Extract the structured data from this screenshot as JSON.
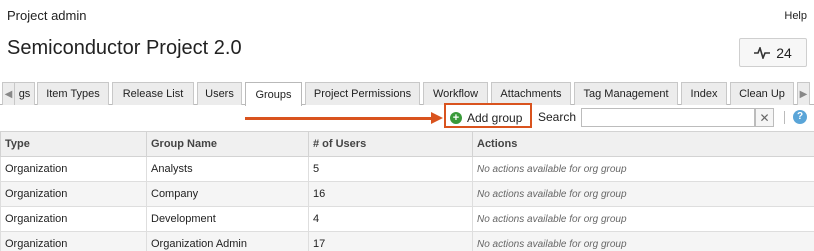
{
  "header": {
    "title": "Project admin",
    "help_label": "Help",
    "project_name": "Semiconductor Project 2.0",
    "activity_count": "24"
  },
  "tabs": {
    "items": [
      {
        "label": "gs"
      },
      {
        "label": "Item Types"
      },
      {
        "label": "Release List"
      },
      {
        "label": "Users"
      },
      {
        "label": "Groups",
        "active": true
      },
      {
        "label": "Project Permissions"
      },
      {
        "label": "Workflow"
      },
      {
        "label": "Attachments"
      },
      {
        "label": "Tag Management"
      },
      {
        "label": "Index"
      },
      {
        "label": "Clean Up"
      }
    ]
  },
  "toolbar": {
    "add_group_label": "Add group",
    "search_label": "Search",
    "search_value": "",
    "search_placeholder": ""
  },
  "table": {
    "columns": [
      "Type",
      "Group Name",
      "# of Users",
      "Actions"
    ],
    "rows": [
      {
        "type": "Organization",
        "name": "Analysts",
        "users": "5",
        "actions": "No actions available for org group"
      },
      {
        "type": "Organization",
        "name": "Company",
        "users": "16",
        "actions": "No actions available for org group"
      },
      {
        "type": "Organization",
        "name": "Development",
        "users": "4",
        "actions": "No actions available for org group"
      },
      {
        "type": "Organization",
        "name": "Organization Admin",
        "users": "17",
        "actions": "No actions available for org group"
      }
    ]
  },
  "icons": {
    "activity": "activity-pulse-icon",
    "add": "plus-circle-icon",
    "clear": "clear-x-icon",
    "help": "help-question-icon",
    "scroll_left": "scroll-left-icon",
    "scroll_right": "scroll-right-icon"
  },
  "colors": {
    "highlight": "#d9531e",
    "add_icon": "#3a9a3a",
    "help_icon": "#5aa5d8"
  }
}
